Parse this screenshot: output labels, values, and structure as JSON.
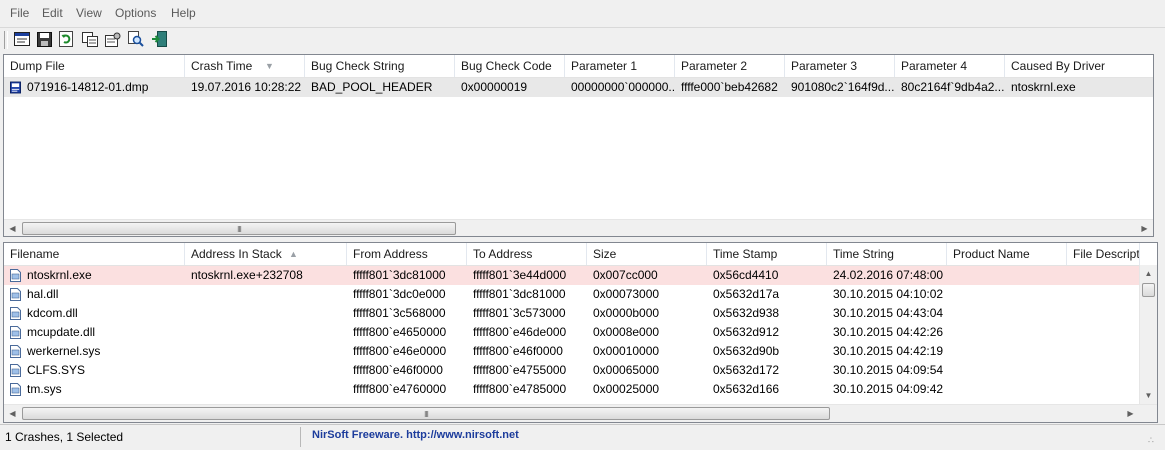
{
  "menu": {
    "items": [
      "File",
      "Edit",
      "View",
      "Options",
      "Help"
    ]
  },
  "toolbar": {
    "buttons": [
      "html-report-icon",
      "save-icon",
      "refresh-icon",
      "copy-icon",
      "properties-icon",
      "find-icon",
      "exit-icon"
    ]
  },
  "crash_list": {
    "columns": [
      "Dump File",
      "Crash Time",
      "Bug Check String",
      "Bug Check Code",
      "Parameter 1",
      "Parameter 2",
      "Parameter 3",
      "Parameter 4",
      "Caused By Driver"
    ],
    "sorted_column": "Crash Time",
    "rows": [
      [
        "071916-14812-01.dmp",
        "19.07.2016 10:28:22",
        "BAD_POOL_HEADER",
        "0x00000019",
        "00000000`000000...",
        "ffffe000`beb42682",
        "901080c2`164f9d...",
        "80c2164f`9db4a2...",
        "ntoskrnl.exe"
      ]
    ],
    "selected_row": 0
  },
  "driver_list": {
    "columns": [
      "Filename",
      "Address In Stack",
      "From Address",
      "To Address",
      "Size",
      "Time Stamp",
      "Time String",
      "Product Name",
      "File Descript"
    ],
    "sorted_column": "Address In Stack",
    "rows": [
      [
        "ntoskrnl.exe",
        "ntoskrnl.exe+232708",
        "fffff801`3dc81000",
        "fffff801`3e44d000",
        "0x007cc000",
        "0x56cd4410",
        "24.02.2016 07:48:00",
        "",
        ""
      ],
      [
        "hal.dll",
        "",
        "fffff801`3dc0e000",
        "fffff801`3dc81000",
        "0x00073000",
        "0x5632d17a",
        "30.10.2015 04:10:02",
        "",
        ""
      ],
      [
        "kdcom.dll",
        "",
        "fffff801`3c568000",
        "fffff801`3c573000",
        "0x0000b000",
        "0x5632d938",
        "30.10.2015 04:43:04",
        "",
        ""
      ],
      [
        "mcupdate.dll",
        "",
        "fffff800`e4650000",
        "fffff800`e46de000",
        "0x0008e000",
        "0x5632d912",
        "30.10.2015 04:42:26",
        "",
        ""
      ],
      [
        "werkernel.sys",
        "",
        "fffff800`e46e0000",
        "fffff800`e46f0000",
        "0x00010000",
        "0x5632d90b",
        "30.10.2015 04:42:19",
        "",
        ""
      ],
      [
        "CLFS.SYS",
        "",
        "fffff800`e46f0000",
        "fffff800`e4755000",
        "0x00065000",
        "0x5632d172",
        "30.10.2015 04:09:54",
        "",
        ""
      ],
      [
        "tm.sys",
        "",
        "fffff800`e4760000",
        "fffff800`e4785000",
        "0x00025000",
        "0x5632d166",
        "30.10.2015 04:09:42",
        "",
        ""
      ]
    ],
    "highlighted_row": 0
  },
  "status": {
    "selection": "1 Crashes, 1 Selected",
    "credit": "NirSoft Freeware.  http://www.nirsoft.net"
  },
  "colors": {
    "highlight_row": "#fbe0e0",
    "selected_row": "#e8e8e8",
    "credit_text": "#1c3c9c"
  }
}
